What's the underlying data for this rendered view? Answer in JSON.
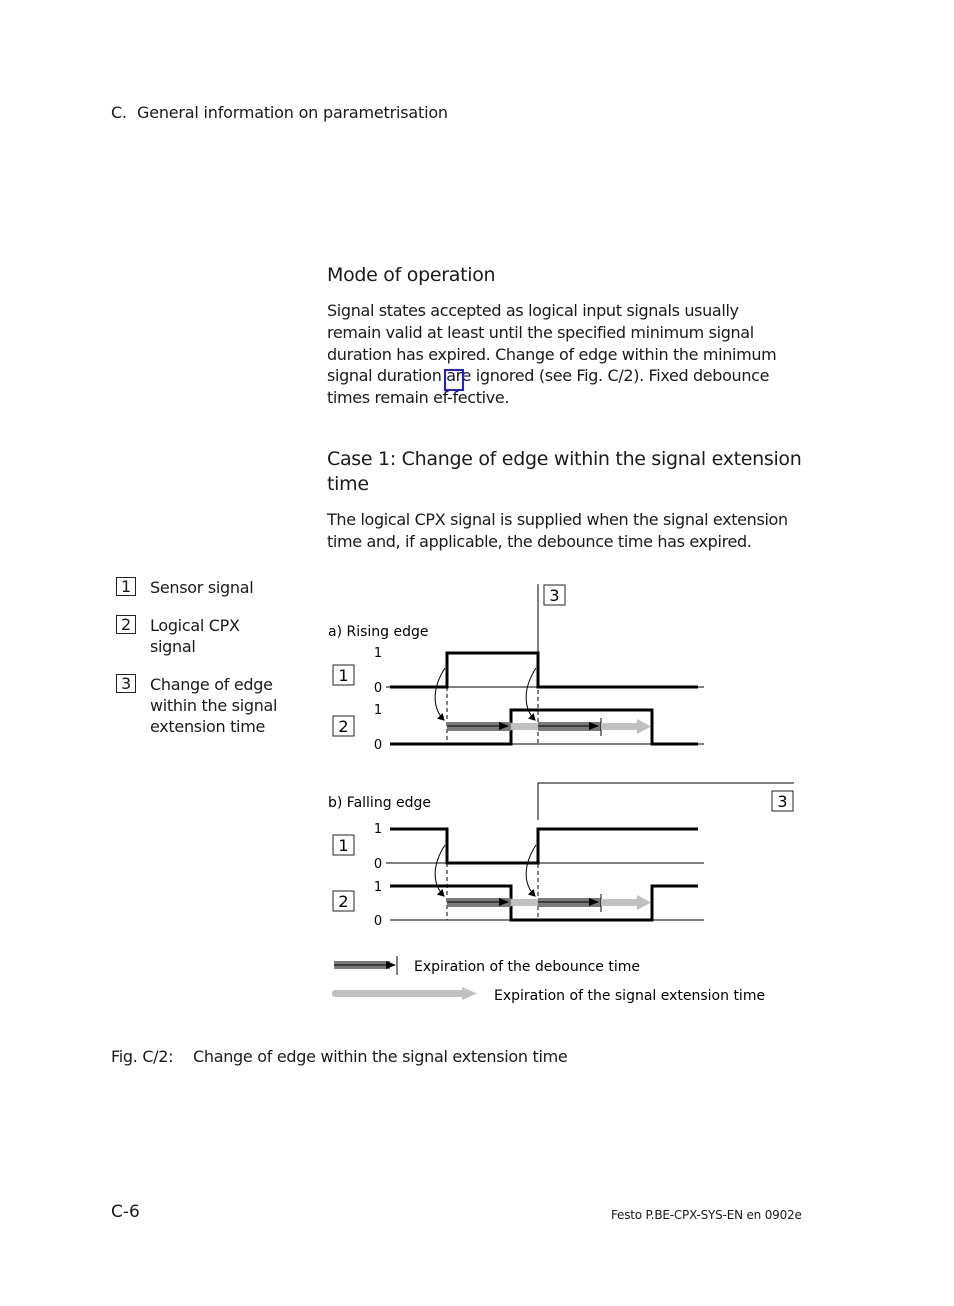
{
  "header": {
    "section": "C.",
    "title": "General information on parametrisation"
  },
  "mode_section": {
    "heading": "Mode of operation",
    "paragraph": "Signal states accepted as logical input signals usually remain valid at least until the specified minimum signal duration has expired. Change of edge within the minimum signal duration are ignored (see Fig. C/2). Fixed debounce times remain ef-fective."
  },
  "case_section": {
    "heading_line1": "Case 1: Change of edge within the signal extension",
    "heading_line2": "time",
    "paragraph": "The logical CPX signal is supplied when the signal extension time and, if applicable, the debounce time has expired."
  },
  "legend": [
    {
      "num": "1",
      "lines": [
        "Sensor signal"
      ]
    },
    {
      "num": "2",
      "lines": [
        "Logical CPX",
        "signal"
      ]
    },
    {
      "num": "3",
      "lines": [
        "Change of edge",
        "within the signal",
        "extension time"
      ]
    }
  ],
  "diagram": {
    "panel_a": {
      "label": "a) Rising edge",
      "marker": "3",
      "rows": [
        {
          "num": "1",
          "level_hi": "1",
          "level_lo": "0",
          "waveform": [
            [
              0,
              0
            ],
            [
              0.18,
              0
            ],
            [
              0.18,
              1
            ],
            [
              0.48,
              1
            ],
            [
              0.48,
              0
            ],
            [
              1,
              0
            ]
          ]
        },
        {
          "num": "2",
          "level_hi": "1",
          "level_lo": "0",
          "waveform": [
            [
              0,
              0
            ],
            [
              0.38,
              0
            ],
            [
              0.38,
              1
            ],
            [
              0.85,
              1
            ],
            [
              0.85,
              0
            ],
            [
              1,
              0
            ]
          ]
        }
      ]
    },
    "panel_b": {
      "label": "b) Falling edge",
      "marker": "3",
      "rows": [
        {
          "num": "1",
          "level_hi": "1",
          "level_lo": "0",
          "waveform": [
            [
              0,
              1
            ],
            [
              0.18,
              1
            ],
            [
              0.18,
              0
            ],
            [
              0.48,
              0
            ],
            [
              0.48,
              1
            ],
            [
              1,
              1
            ]
          ]
        },
        {
          "num": "2",
          "level_hi": "1",
          "level_lo": "0",
          "waveform": [
            [
              0,
              1
            ],
            [
              0.38,
              1
            ],
            [
              0.38,
              0
            ],
            [
              0.85,
              0
            ],
            [
              0.85,
              1
            ],
            [
              1,
              1
            ]
          ]
        }
      ]
    },
    "key": {
      "debounce_label": "Expiration of the debounce time",
      "extension_label": "Expiration of the signal extension time"
    },
    "colors": {
      "debounce": "#7a7a7a",
      "extension": "#c0c0c0",
      "line": "#000000"
    }
  },
  "figure_caption": {
    "label": "Fig. C/2:",
    "text": "Change of edge within the signal extension time"
  },
  "footer": {
    "page": "C-6",
    "doc_ref": "Festo  P.BE-CPX-SYS-EN  en 0902e"
  }
}
